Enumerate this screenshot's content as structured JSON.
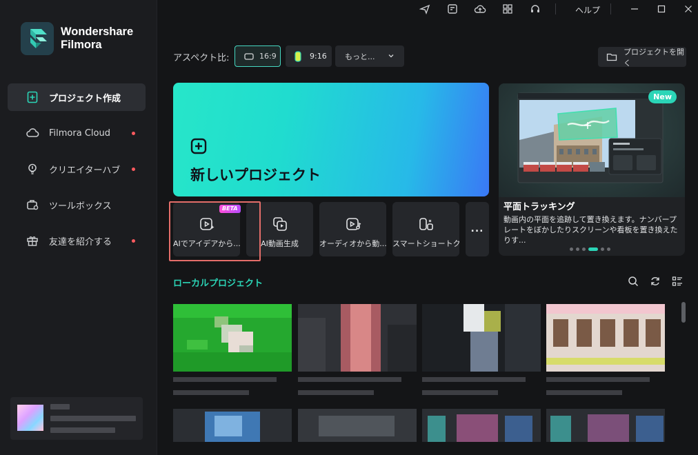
{
  "app": {
    "brand_line1": "Wondershare",
    "brand_line2": "Filmora",
    "help_label": "ヘルプ"
  },
  "titlebar": {
    "icons": [
      "send-icon",
      "media-download-icon",
      "cloud-upload-icon",
      "grid-apps-icon",
      "headset-support-icon"
    ],
    "window_controls": [
      "minimize-icon",
      "maximize-icon",
      "close-icon"
    ]
  },
  "sidebar": {
    "items": [
      {
        "label": "プロジェクト作成",
        "icon": "new-project-icon",
        "active": true,
        "dot": false
      },
      {
        "label": "Filmora Cloud",
        "icon": "cloud-icon",
        "active": false,
        "dot": true
      },
      {
        "label": "クリエイターハブ",
        "icon": "bulb-icon",
        "active": false,
        "dot": true
      },
      {
        "label": "ツールボックス",
        "icon": "toolbox-icon",
        "active": false,
        "dot": false
      },
      {
        "label": "友達を紹介する",
        "icon": "gift-icon",
        "active": false,
        "dot": true
      }
    ],
    "user": {
      "name_hidden": true
    }
  },
  "aspect": {
    "label": "アスペクト比:",
    "options": [
      {
        "label": "16:9",
        "selected": true
      },
      {
        "label": "9:16",
        "selected": false
      }
    ],
    "more_label": "もっと...",
    "open_project_label": "プロジェクトを開く"
  },
  "new_project": {
    "title": "新しいプロジェクト"
  },
  "feature": {
    "badge": "New",
    "title": "平面トラッキング",
    "description": "動画内の平面を追跡して置き換えます。ナンバープレートをぼかしたりスクリーンや看板を置き換えたりす...",
    "slides_total": 6,
    "slide_active": 4
  },
  "tools": [
    {
      "label": "AIでアイデアから...",
      "icon": "ai-idea-video-icon",
      "badge": "BETA"
    },
    {
      "label": "AI動画生成",
      "icon": "ai-video-generate-icon"
    },
    {
      "label": "オーディオから動...",
      "icon": "audio-to-video-icon"
    },
    {
      "label": "スマートショートク...",
      "icon": "smart-short-clip-icon"
    },
    {
      "label": "...",
      "icon": "more-icon"
    }
  ],
  "local": {
    "title": "ローカルプロジェクト",
    "actions": [
      "search-icon",
      "refresh-icon",
      "list-view-icon"
    ]
  },
  "colors": {
    "accent": "#2bd5b7",
    "background": "#141517",
    "sidebar": "#1b1c1f",
    "highlight": "#e56e6a"
  }
}
